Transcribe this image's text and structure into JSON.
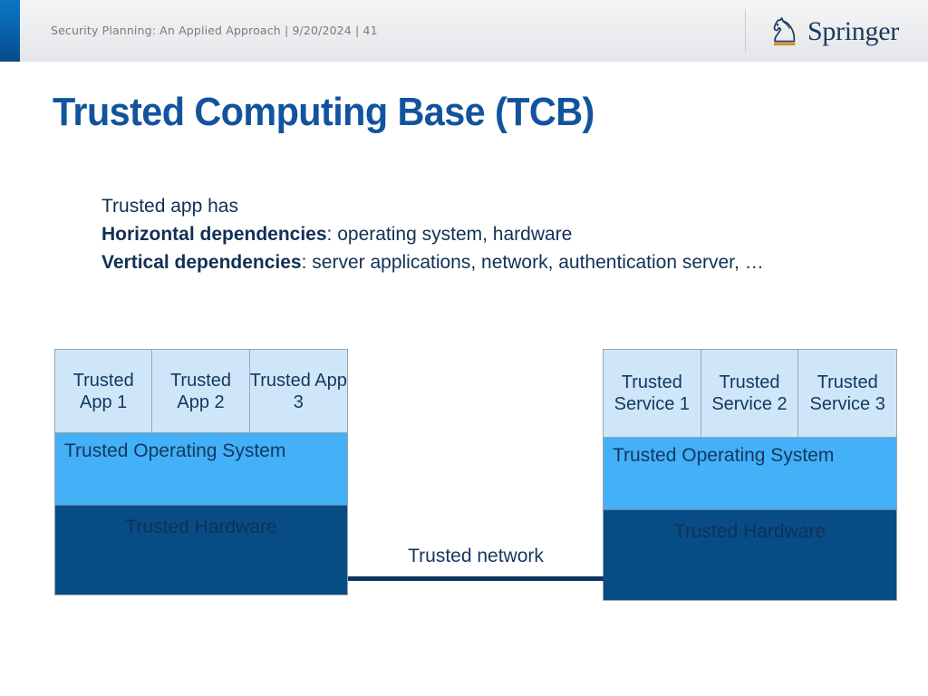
{
  "header": {
    "breadcrumb": "Security Planning: An Applied Approach | 9/20/2024 | 41",
    "logo_wordmark": "Springer",
    "accent_color": "#0a67b2"
  },
  "title": "Trusted Computing Base (TCB)",
  "body": {
    "line1": "Trusted app has",
    "line2_bold": "Horizontal dependencies",
    "line2_rest": ": operating system, hardware",
    "line3_bold": "Vertical dependencies",
    "line3_rest": ": server applications, network, authentication server, …"
  },
  "diagram": {
    "colors": {
      "app_cell": "#cfe6f9",
      "os_band": "#43b0f7",
      "hardware_band": "#084c86",
      "text": "#14375f",
      "link": "#10365f"
    },
    "left_stack": {
      "cells": [
        "Trusted App 1",
        "Trusted App 2",
        "Trusted App 3"
      ],
      "os_label": "Trusted Operating System",
      "hardware_label": "Trusted Hardware"
    },
    "right_stack": {
      "cells": [
        "Trusted Service 1",
        "Trusted Service 2",
        "Trusted Service 3"
      ],
      "os_label": "Trusted Operating System",
      "hardware_label": "Trusted Hardware"
    },
    "network_label": "Trusted network"
  }
}
